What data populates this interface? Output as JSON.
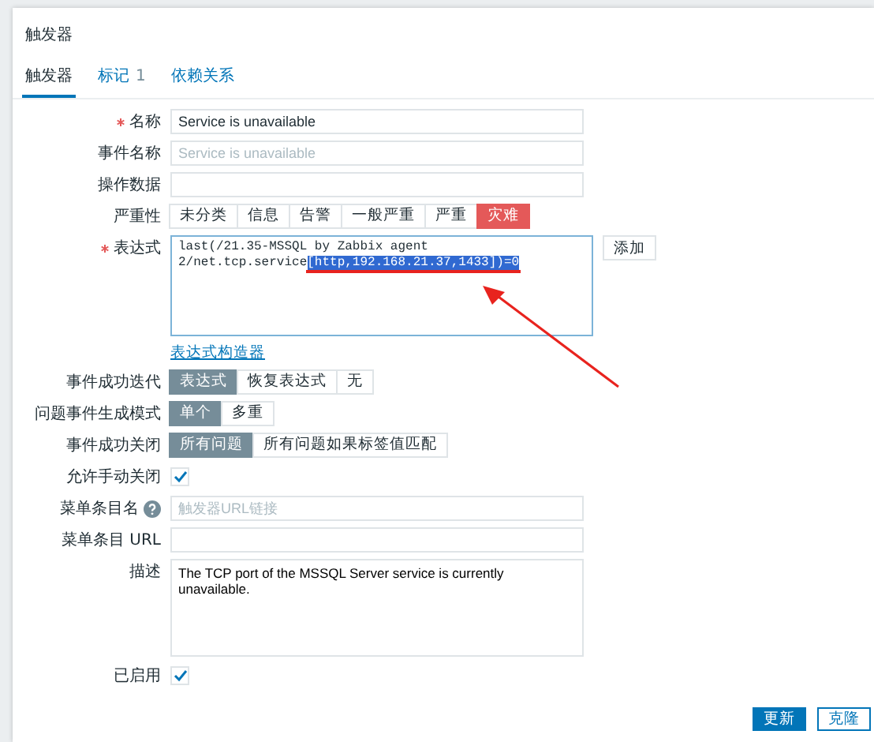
{
  "dialog": {
    "title": "触发器"
  },
  "tabs": [
    {
      "label": "触发器",
      "selected": true
    },
    {
      "label": "标记",
      "count": "1",
      "selected": false
    },
    {
      "label": "依赖关系",
      "selected": false
    }
  ],
  "fields": [
    {
      "kind": "text",
      "label": "名称",
      "required": true,
      "value": "Service is unavailable"
    },
    {
      "kind": "text",
      "label": "事件名称",
      "required": false,
      "placeholder": "Service is unavailable"
    },
    {
      "kind": "text",
      "label": "操作数据",
      "required": false
    },
    {
      "kind": "severity",
      "label": "严重性",
      "required": false,
      "options": [
        {
          "label": "未分类",
          "selected": false
        },
        {
          "label": "信息",
          "selected": false
        },
        {
          "label": "告警",
          "selected": false
        },
        {
          "label": "一般严重",
          "selected": false
        },
        {
          "label": "严重",
          "selected": false
        },
        {
          "label": "灾难",
          "selected": true
        }
      ]
    },
    {
      "kind": "expression",
      "label": "表达式",
      "required": true,
      "segments": [
        {
          "text": "last(/21.35-MSSQL by Zabbix agent 2/net.tcp.service",
          "selected": false
        },
        {
          "text": "[http,192.168.21.37,1433])=0",
          "selected": true
        }
      ],
      "button": "添加",
      "link": "表达式构造器"
    },
    {
      "kind": "radio",
      "label": "事件成功迭代",
      "required": false,
      "options": [
        {
          "label": "表达式",
          "selected": true
        },
        {
          "label": "恢复表达式",
          "selected": false
        },
        {
          "label": "无",
          "selected": false
        }
      ]
    },
    {
      "kind": "radio",
      "label": "问题事件生成模式",
      "required": false,
      "options": [
        {
          "label": "单个",
          "selected": true
        },
        {
          "label": "多重",
          "selected": false
        }
      ]
    },
    {
      "kind": "radio",
      "label": "事件成功关闭",
      "required": false,
      "options": [
        {
          "label": "所有问题",
          "selected": true
        },
        {
          "label": "所有问题如果标签值匹配",
          "selected": false
        }
      ]
    },
    {
      "kind": "checkbox",
      "label": "允许手动关闭",
      "required": false,
      "checked": true
    },
    {
      "kind": "text",
      "label": "菜单条目名",
      "required": false,
      "help": true,
      "placeholder": "触发器URL链接"
    },
    {
      "kind": "text",
      "label": "菜单条目 URL",
      "required": false
    },
    {
      "kind": "textarea",
      "label": "描述",
      "required": false,
      "value": "The TCP port of the MSSQL Server service is currently unavailable."
    },
    {
      "kind": "checkbox",
      "label": "已启用",
      "required": false,
      "checked": true
    }
  ],
  "buttons": [
    {
      "label": "更新",
      "primary": true
    },
    {
      "label": "克隆",
      "primary": false
    }
  ]
}
